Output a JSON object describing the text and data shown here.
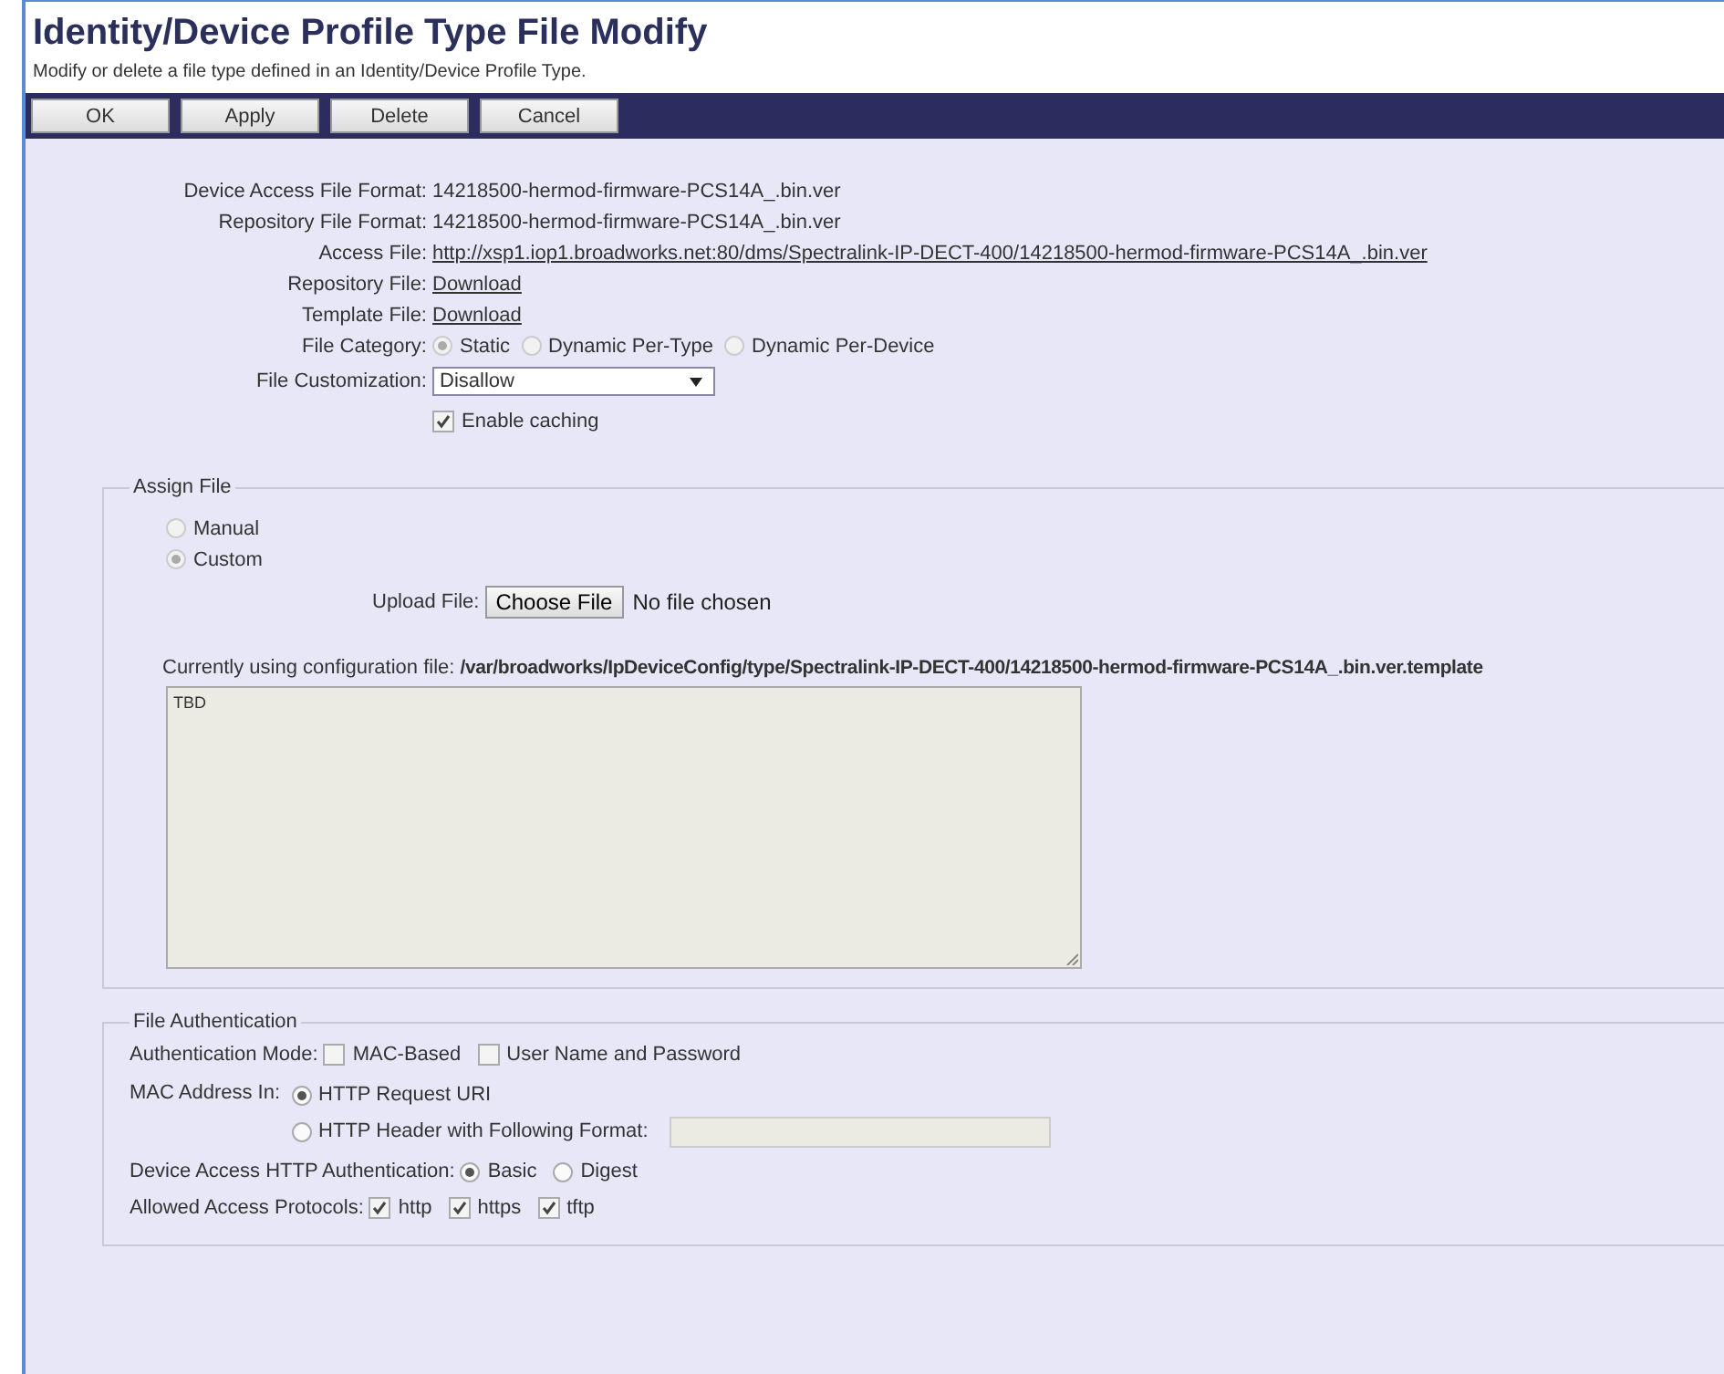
{
  "title": "Identity/Device Profile Type File Modify",
  "subtitle": "Modify or delete a file type defined in an Identity/Device Profile Type.",
  "buttons": [
    "OK",
    "Apply",
    "Delete",
    "Cancel"
  ],
  "fields": [
    {
      "kind": "text",
      "label": "Device Access File Format:",
      "value": "14218500-hermod-firmware-PCS14A_.bin.ver"
    },
    {
      "kind": "text",
      "label": "Repository File Format:",
      "value": "14218500-hermod-firmware-PCS14A_.bin.ver"
    },
    {
      "kind": "link",
      "label": "Access File:",
      "value": "http://xsp1.iop1.broadworks.net:80/dms/Spectralink-IP-DECT-400/14218500-hermod-firmware-PCS14A_.bin.ver"
    },
    {
      "kind": "link",
      "label": "Repository File:",
      "value": "Download"
    },
    {
      "kind": "link",
      "label": "Template File:",
      "value": "Download"
    }
  ],
  "file_category": {
    "label": "File Category:",
    "options": [
      {
        "label": "Static",
        "selected": true
      },
      {
        "label": "Dynamic Per-Type",
        "selected": false
      },
      {
        "label": "Dynamic Per-Device",
        "selected": false
      }
    ]
  },
  "file_customization": {
    "label": "File Customization:",
    "value": "Disallow"
  },
  "enable_caching": {
    "label": "Enable caching",
    "checked": true
  },
  "assign_file": {
    "legend": "Assign File",
    "options": [
      {
        "label": "Manual",
        "selected": false
      },
      {
        "label": "Custom",
        "selected": true
      }
    ],
    "upload": {
      "label": "Upload File:",
      "button": "Choose File",
      "status": "No file chosen"
    },
    "current_label": "Currently using configuration file:",
    "current_path": "/var/broadworks/IpDeviceConfig/type/Spectralink-IP-DECT-400/14218500-hermod-firmware-PCS14A_.bin.ver.template",
    "content": "TBD"
  },
  "file_authentication": {
    "legend": "File Authentication",
    "authentication_mode": {
      "label": "Authentication Mode:",
      "options": [
        {
          "label": "MAC-Based",
          "checked": false
        },
        {
          "label": "User Name and Password",
          "checked": false
        }
      ]
    },
    "mac_address_in": {
      "label": "MAC Address In:",
      "options": [
        {
          "label": "HTTP Request URI",
          "selected": true
        },
        {
          "label": "HTTP Header with Following Format:",
          "selected": false
        }
      ]
    },
    "device_access_auth": {
      "label": "Device Access HTTP Authentication:",
      "options": [
        {
          "label": "Basic",
          "selected": true
        },
        {
          "label": "Digest",
          "selected": false
        }
      ]
    },
    "allowed_protocols": {
      "label": "Allowed Access Protocols:",
      "options": [
        {
          "label": "http",
          "checked": true
        },
        {
          "label": "https",
          "checked": true
        },
        {
          "label": "tftp",
          "checked": true
        }
      ]
    }
  }
}
